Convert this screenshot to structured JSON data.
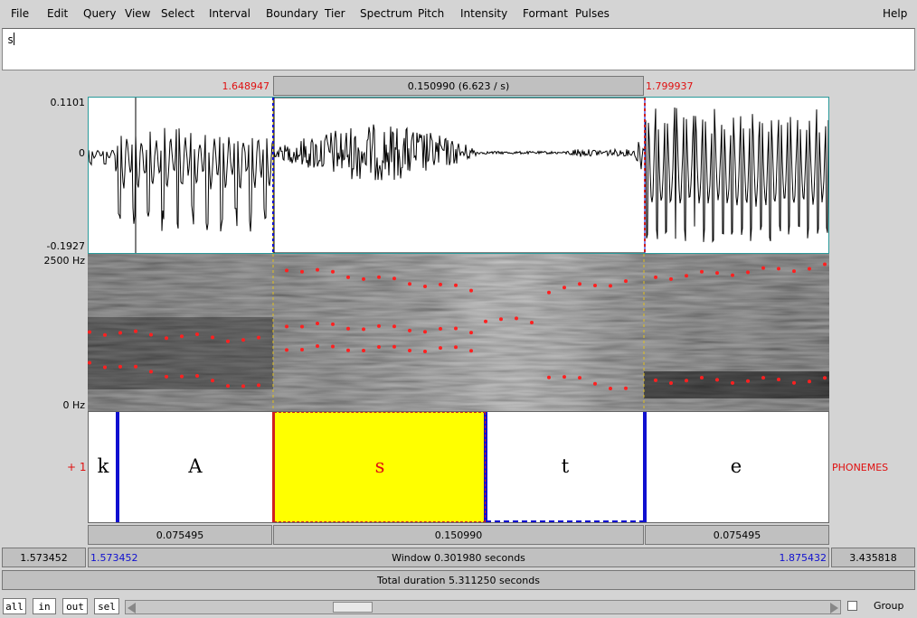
{
  "menu": {
    "items": [
      "File",
      "Edit",
      "Query",
      "View",
      "Select",
      "Interval",
      "Boundary",
      "Tier",
      "Spectrum",
      "Pitch",
      "Intensity",
      "Formant",
      "Pulses"
    ],
    "help": "Help"
  },
  "text_box": {
    "value": "s"
  },
  "selection": {
    "start_time": "1.648947",
    "end_time": "1.799937",
    "duration_label": "0.150990 (6.623 / s)"
  },
  "waveform": {
    "y_max": "0.1101",
    "y_zero": "0",
    "y_min": "-0.1927"
  },
  "spectrogram": {
    "f_max": "2500 Hz",
    "f_min": "0 Hz"
  },
  "tier": {
    "number_label": "+ 1",
    "name": "PHONEMES",
    "intervals": [
      {
        "label": "k",
        "selected": false
      },
      {
        "label": "A",
        "selected": false
      },
      {
        "label": "s",
        "selected": true
      },
      {
        "label": "t",
        "selected": false
      },
      {
        "label": "e",
        "selected": false
      }
    ]
  },
  "duration_row": {
    "left": "0.075495",
    "middle": "0.150990",
    "right": "0.075495"
  },
  "window_row": {
    "total_start": "1.573452",
    "visible_start": "1.573452",
    "window_label": "Window 0.301980 seconds",
    "visible_end": "1.875432",
    "total_end": "3.435818"
  },
  "total_row": {
    "label": "Total duration 5.311250 seconds"
  },
  "bottom": {
    "buttons": [
      "all",
      "in",
      "out",
      "sel"
    ],
    "group_label": "Group",
    "group_checked": false,
    "scroll_position": 0.3
  },
  "colors": {
    "selection": "#ffff00",
    "boundary": "#1010d0",
    "formant": "#ff2020",
    "accent_red": "#e01010"
  }
}
